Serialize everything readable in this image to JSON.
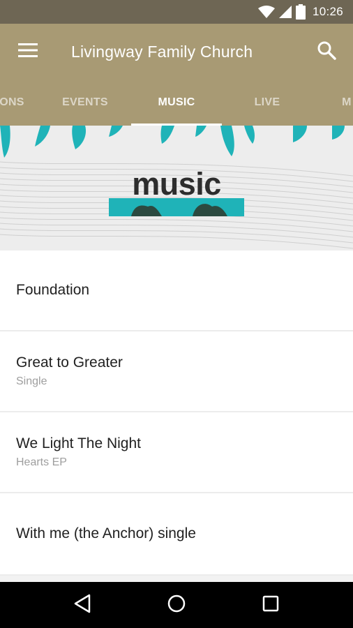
{
  "status_bar": {
    "time": "10:26"
  },
  "app_bar": {
    "title": "Livingway Family Church"
  },
  "tabs": [
    {
      "label": "ONS"
    },
    {
      "label": "EVENTS"
    },
    {
      "label": "MUSIC"
    },
    {
      "label": "LIVE"
    },
    {
      "label": "M"
    }
  ],
  "active_tab": "MUSIC",
  "banner": {
    "text": "music"
  },
  "items": [
    {
      "title": "Foundation",
      "subtitle": ""
    },
    {
      "title": "Great to Greater",
      "subtitle": "Single"
    },
    {
      "title": "We Light The Night",
      "subtitle": "Hearts EP"
    },
    {
      "title": "With me (the Anchor) single",
      "subtitle": ""
    }
  ],
  "colors": {
    "status_bar": "#6e6654",
    "app_bar": "#a89a74",
    "banner_accent": "#1fb3b8",
    "nav_bar": "#000000"
  },
  "icons": {
    "menu": "hamburger-menu-icon",
    "search": "search-icon",
    "wifi": "wifi-icon",
    "signal": "cell-signal-icon",
    "battery": "battery-icon",
    "back": "back-triangle-icon",
    "home": "home-circle-icon",
    "recents": "recents-square-icon"
  }
}
